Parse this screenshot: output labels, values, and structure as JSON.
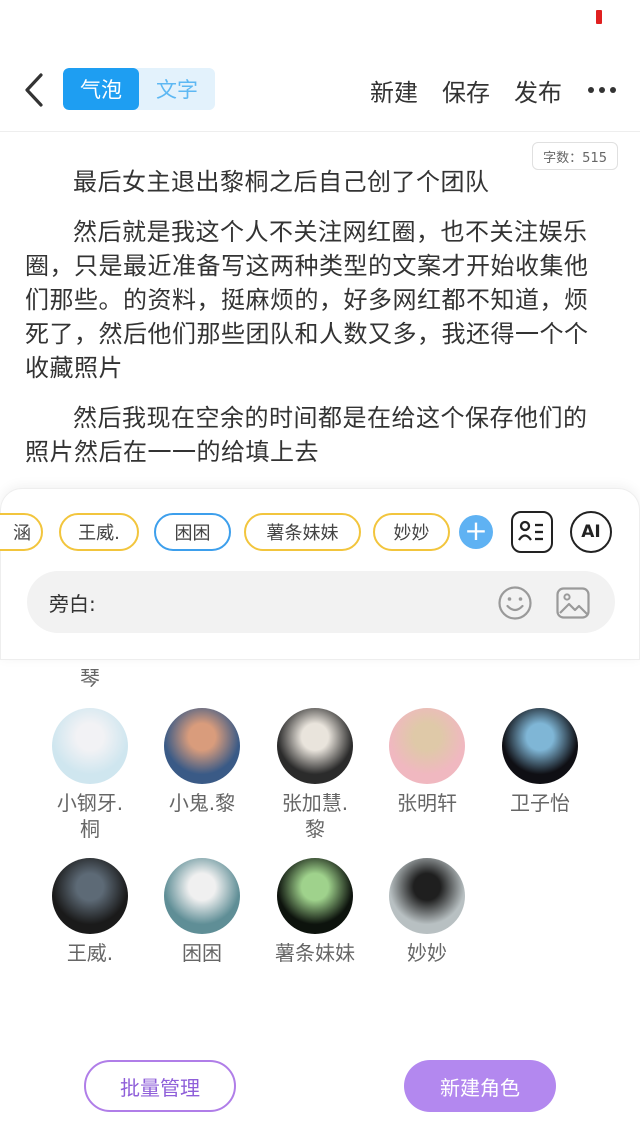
{
  "header": {
    "mode_bubble": "气泡",
    "mode_text": "文字",
    "new_label": "新建",
    "save_label": "保存",
    "publish_label": "发布"
  },
  "word_count": "字数：515",
  "paragraphs": [
    "最后女主退出黎桐之后自己创了个团队",
    "然后就是我这个人不关注网红圈，也不关注娱乐圈，只是最近准备写这两种类型的文案才开始收集他们那些。的资料，挺麻烦的，好多网红都不知道，烦死了，然后他们那些团队和人数又多，我还得一个个收藏照片",
    "然后我现在空余的时间都是在给这个保存他们的照片然后在一一的给填上去"
  ],
  "character_chips": [
    {
      "label": "涵",
      "selected": false
    },
    {
      "label": "王威.",
      "selected": false
    },
    {
      "label": "困困",
      "selected": true
    },
    {
      "label": "薯条妹妹",
      "selected": false
    },
    {
      "label": "妙妙",
      "selected": false
    }
  ],
  "ai_label": "AI",
  "input": {
    "label": "旁白:"
  },
  "cut_row": {
    "last_line": "琴"
  },
  "roles": [
    {
      "name": "小钢牙.\n桐",
      "colors": [
        "#cfe6ef",
        "#f2f2f5"
      ]
    },
    {
      "name": "小鬼.黎",
      "colors": [
        "#3a5a86",
        "#d99c7c"
      ]
    },
    {
      "name": "张加慧.\n黎",
      "colors": [
        "#2b2b2b",
        "#e9e4dc"
      ]
    },
    {
      "name": "张明轩",
      "colors": [
        "#f0b8c0",
        "#dfc9a8"
      ]
    },
    {
      "name": "卫子怡",
      "colors": [
        "#0f0f14",
        "#7fb6d6"
      ]
    },
    {
      "name": "王威.",
      "colors": [
        "#1a1a1a",
        "#5d6a76"
      ]
    },
    {
      "name": "困困",
      "colors": [
        "#5f8e96",
        "#f0f0f0"
      ]
    },
    {
      "name": "薯条妹妹",
      "colors": [
        "#0d130d",
        "#9fd28c"
      ]
    },
    {
      "name": "妙妙",
      "colors": [
        "#b8c0c2",
        "#1f1f1f"
      ]
    }
  ],
  "buttons": {
    "batch_manage": "批量管理",
    "new_role": "新建角色"
  },
  "colors": {
    "accent_blue": "#1e9ef2",
    "chip_yellow": "#f2c53d",
    "purple": "#b388ef"
  }
}
